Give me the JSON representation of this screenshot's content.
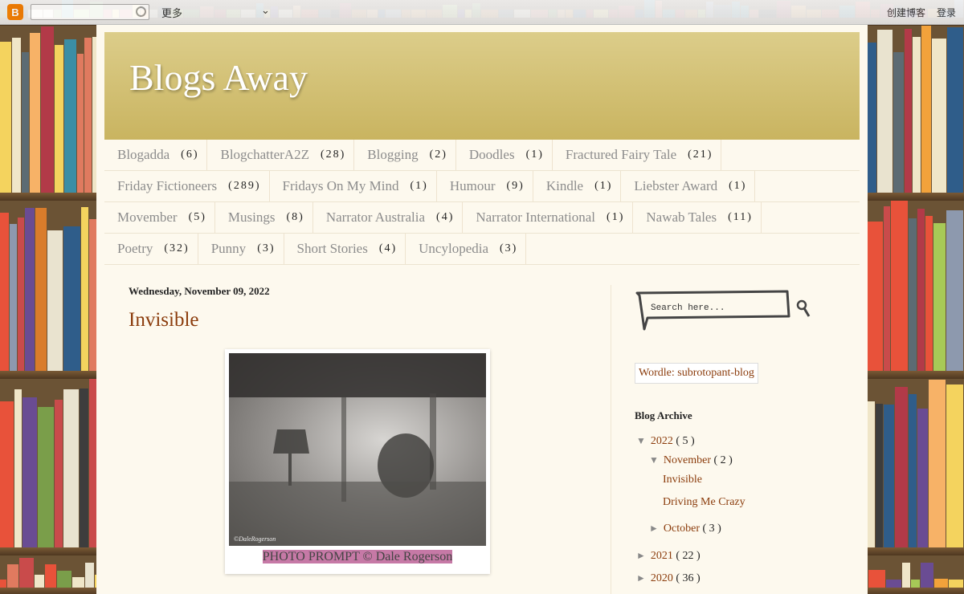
{
  "navbar": {
    "more": "更多",
    "create_blog": "创建博客",
    "login": "登录"
  },
  "blog": {
    "title": "Blogs Away"
  },
  "labels": [
    [
      {
        "name": "Blogadda",
        "count": "(6)"
      },
      {
        "name": "BlogchatterA2Z",
        "count": "(28)"
      },
      {
        "name": "Blogging",
        "count": "(2)"
      },
      {
        "name": "Doodles",
        "count": "(1)"
      },
      {
        "name": "Fractured Fairy Tale",
        "count": "(21)"
      }
    ],
    [
      {
        "name": "Friday Fictioneers",
        "count": "(289)"
      },
      {
        "name": "Fridays On My Mind",
        "count": "(1)"
      },
      {
        "name": "Humour",
        "count": "(9)"
      },
      {
        "name": "Kindle",
        "count": "(1)"
      },
      {
        "name": "Liebster Award",
        "count": "(1)"
      }
    ],
    [
      {
        "name": "Movember",
        "count": "(5)"
      },
      {
        "name": "Musings",
        "count": "(8)"
      },
      {
        "name": "Narrator Australia",
        "count": "(4)"
      },
      {
        "name": "Narrator International",
        "count": "(1)"
      },
      {
        "name": "Nawab Tales",
        "count": "(11)"
      }
    ],
    [
      {
        "name": "Poetry",
        "count": "(32)"
      },
      {
        "name": "Punny",
        "count": "(3)"
      },
      {
        "name": "Short Stories",
        "count": "(4)"
      },
      {
        "name": "Uncylopedia",
        "count": "(3)"
      }
    ]
  ],
  "post": {
    "date": "Wednesday, November 09, 2022",
    "title": "Invisible",
    "photo_credit": "©DaleRogerson",
    "caption": "PHOTO PROMPT © Dale Rogerson"
  },
  "sidebar": {
    "search_placeholder": "Search here...",
    "wordle": "Wordle: subrotopant-blog",
    "archive_title": "Blog Archive",
    "archive": {
      "y2022": {
        "label": "2022",
        "count": "( 5 )"
      },
      "nov": {
        "label": "November",
        "count": "( 2 )"
      },
      "post1": "Invisible",
      "post2": "Driving Me Crazy",
      "oct": {
        "label": "October",
        "count": "( 3 )"
      },
      "y2021": {
        "label": "2021",
        "count": "( 22 )"
      },
      "y2020": {
        "label": "2020",
        "count": "( 36 )"
      }
    }
  },
  "colors": {
    "header": "#c9b460",
    "link": "#8b3c0c",
    "page": "#fdf9ee",
    "highlight": "#c679a6"
  }
}
